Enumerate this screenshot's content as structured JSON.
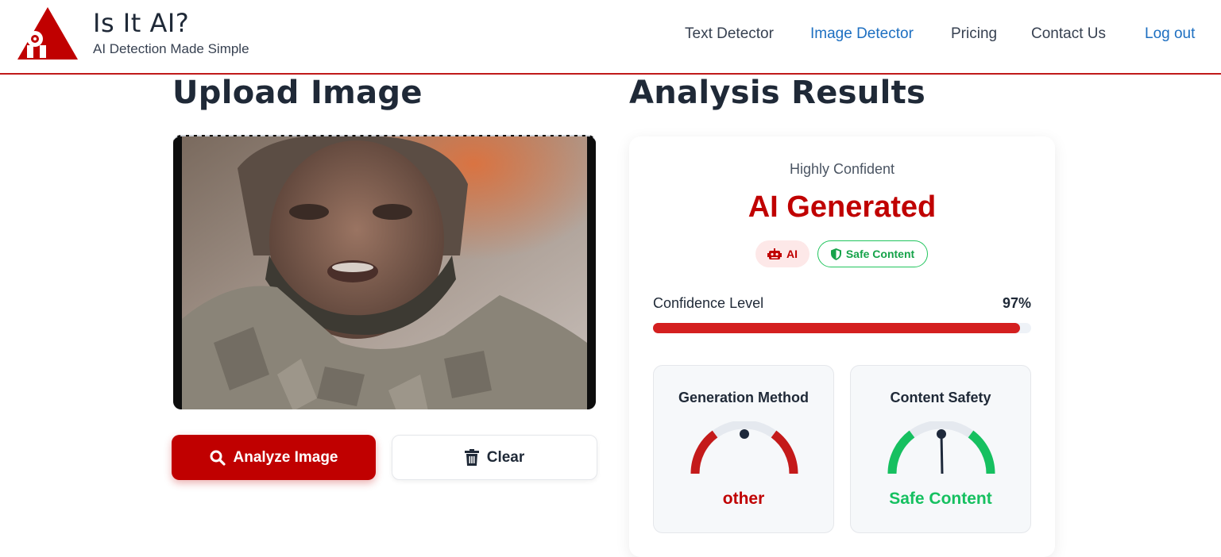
{
  "brand": {
    "title": "Is It AI?",
    "subtitle": "AI Detection Made Simple",
    "accent": "#c00000"
  },
  "nav": {
    "items": [
      {
        "label": "Text Detector"
      },
      {
        "label": "Image Detector",
        "active": true
      },
      {
        "label": "Pricing"
      },
      {
        "label": "Contact Us"
      }
    ],
    "logout": "Log out",
    "link_color": "#1d6fc1"
  },
  "upload": {
    "heading": "Upload Image",
    "analyze_label": "Analyze Image",
    "analyze_icon": "search-icon",
    "clear_label": "Clear",
    "clear_icon": "trash-icon"
  },
  "results": {
    "heading": "Analysis Results",
    "confidence_text": "Highly Confident",
    "verdict": "AI Generated",
    "badges": [
      {
        "label": "AI",
        "icon": "robot-icon",
        "color": "#c00000"
      },
      {
        "label": "Safe Content",
        "icon": "shield-icon",
        "color": "#16a34a"
      }
    ],
    "confidence_label": "Confidence Level",
    "confidence_value": "97%",
    "confidence_fraction": 0.97,
    "generation": {
      "title": "Generation Method",
      "value": "other",
      "color": "#c00000"
    },
    "safety": {
      "title": "Content Safety",
      "value": "Safe Content",
      "color": "#16c060"
    }
  }
}
